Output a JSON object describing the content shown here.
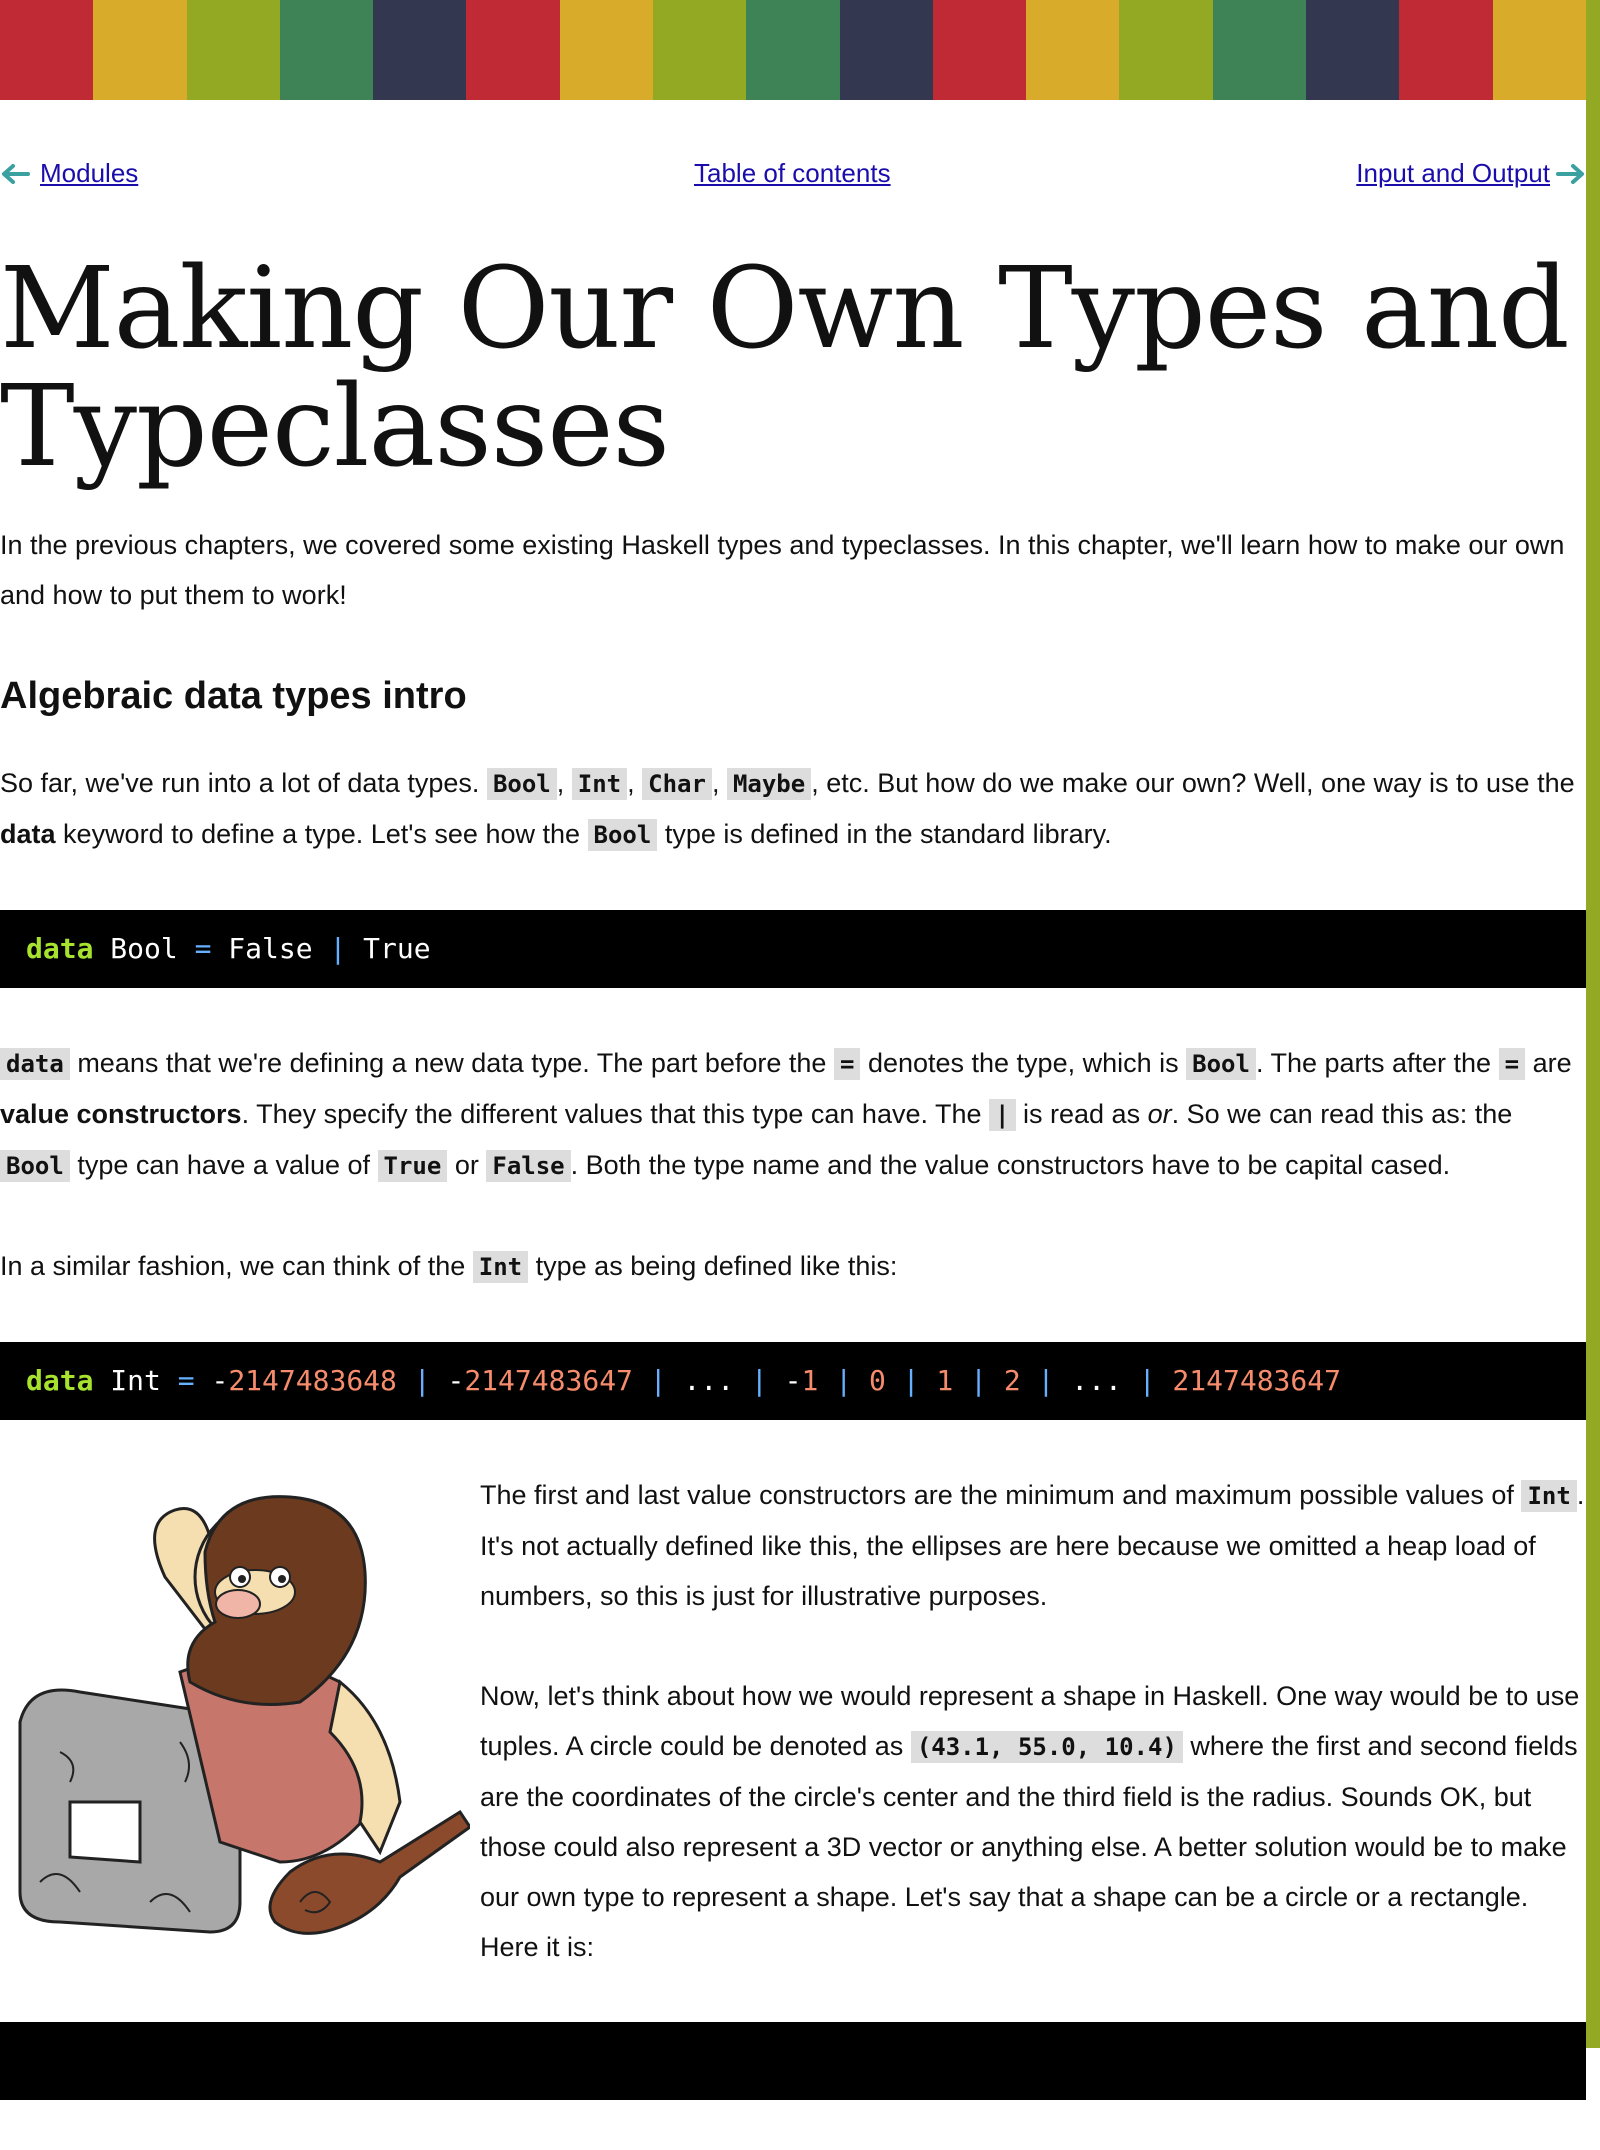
{
  "colors": {
    "stripes": [
      "#c02a35",
      "#d9ab2b",
      "#93a823",
      "#3e8356",
      "#33374f",
      "#c02a35",
      "#d9ab2b",
      "#93a823",
      "#3e8356",
      "#33374f",
      "#c02a35",
      "#d9ab2b",
      "#93a823",
      "#3e8356",
      "#33374f",
      "#c02a35",
      "#d9ab2b",
      "#93a823"
    ],
    "right_bar": "#93a823",
    "link": "#1a0dab",
    "code_bg": "#000000",
    "inline_code_bg": "#dddddd"
  },
  "nav": {
    "prev_label": "Modules",
    "toc_label": "Table of contents",
    "next_label": "Input and Output"
  },
  "title": "Making Our Own Types and Typeclasses",
  "intro": "In the previous chapters, we covered some existing Haskell types and typeclasses. In this chapter, we'll learn how to make our own and how to put them to work!",
  "section1": {
    "heading": "Algebraic data types intro",
    "p1": {
      "a": "So far, we've run into a lot of data types.",
      "code1": "Bool",
      "code2": "Int",
      "code3": "Char",
      "code4": "Maybe",
      "b": ", etc. But how do we make our own? Well, one way is to use the",
      "bold": "data",
      "c": "keyword to define a type. Let's see how the",
      "code5": "Bool",
      "d": "type is defined in the standard library."
    },
    "code_bool": {
      "kw": "data",
      "name": " Bool ",
      "eq": "=",
      "v1": " False ",
      "bar": "|",
      "v2": " True"
    },
    "p2": {
      "code1": "data",
      "a": "means that we're defining a new data type. The part before the",
      "code2": "=",
      "b": "denotes the type, which is",
      "code3": "Bool",
      "c": ". The parts after the",
      "code4": "=",
      "d": "are",
      "bold": "value constructors",
      "e": ". They specify the different values that this type can have. The",
      "code5": "|",
      "f": "is read as",
      "em": "or",
      "g": ". So we can read this as: the",
      "code6": "Bool",
      "h": "type can have a value of",
      "code7": "True",
      "i": "or",
      "code8": "False",
      "j": ". Both the type name and the value constructors have to be capital cased."
    },
    "p3": {
      "a": "In a similar fashion, we can think of the",
      "code1": "Int",
      "b": "type as being defined like this:"
    },
    "code_int": {
      "kw": "data",
      "name": " Int ",
      "eq": "=",
      "t1": " -",
      "n1": "2147483648",
      "t2": " ",
      "bar1": "|",
      "t3": " -",
      "n2": "2147483647",
      "t4": " ",
      "bar2": "|",
      "t5": " ... ",
      "bar3": "|",
      "t6": " -",
      "n3": "1",
      "t7": " ",
      "bar4": "|",
      "t8": " ",
      "n4": "0",
      "t9": " ",
      "bar5": "|",
      "t10": " ",
      "n5": "1",
      "t11": " ",
      "bar6": "|",
      "t12": " ",
      "n6": "2",
      "t13": " ",
      "bar7": "|",
      "t14": " ... ",
      "bar8": "|",
      "t15": " ",
      "n7": "2147483647"
    },
    "p4": {
      "a": "The first and last value constructors are the minimum and maximum possible values of",
      "code1": "Int",
      "b": ". It's not actually defined like this, the ellipses are here because we omitted a heap load of numbers, so this is just for illustrative purposes."
    },
    "p5": {
      "a": "Now, let's think about how we would represent a shape in Haskell. One way would be to use tuples. A circle could be denoted as",
      "code1": "(43.1, 55.0, 10.4)",
      "b": "where the first and second fields are the coordinates of the circle's center and the third field is the radius. Sounds OK, but those could also represent a 3D vector or anything else. A better solution would be to make our own type to represent a shape. Let's say that a shape can be a circle or a rectangle. Here it is:"
    }
  }
}
